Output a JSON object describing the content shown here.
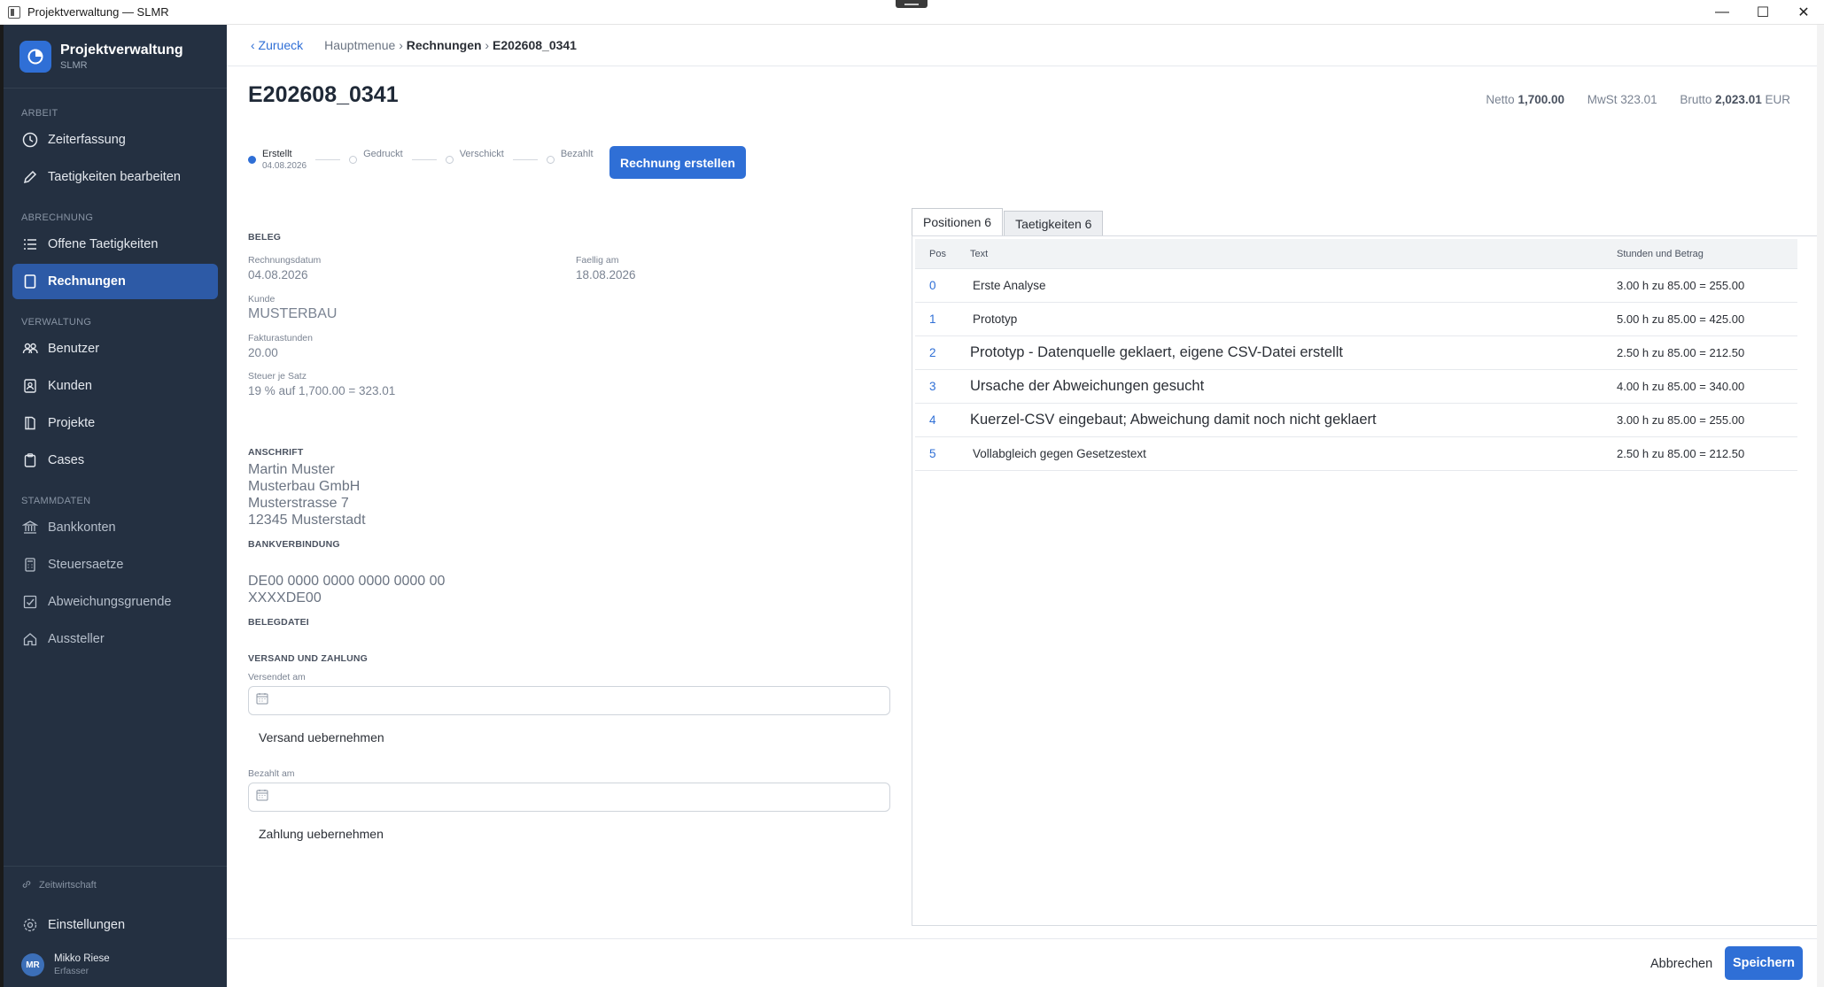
{
  "window": {
    "title": "Projektverwaltung — SLMR",
    "controls": [
      "—",
      "☐",
      "✕"
    ]
  },
  "brand": {
    "title": "Projektverwaltung",
    "subtitle": "SLMR"
  },
  "sidebar": {
    "sections": {
      "arbeit": "ARBEIT",
      "abrechnung": "ABRECHNUNG",
      "verwaltung": "VERWALTUNG",
      "stammdaten": "STAMMDATEN"
    },
    "items": {
      "zeiterfassung": "Zeiterfassung",
      "taetigkeiten_bearbeiten": "Taetigkeiten bearbeiten",
      "offene_taetigkeiten": "Offene Taetigkeiten",
      "rechnungen": "Rechnungen",
      "benutzer": "Benutzer",
      "kunden": "Kunden",
      "projekte": "Projekte",
      "cases": "Cases",
      "bankkonten": "Bankkonten",
      "steuersaetze": "Steuersaetze",
      "abweichungsgruende": "Abweichungsgruende",
      "aussteller": "Aussteller"
    },
    "footer": {
      "zeitwirtschaft": "Zeitwirtschaft",
      "einstellungen": "Einstellungen",
      "user_initials": "MR",
      "user_name": "Mikko Riese",
      "user_role": "Erfasser"
    }
  },
  "topbar": {
    "back": "‹ Zurueck",
    "crumb_home": "Hauptmenue",
    "sep": "›",
    "crumb_section": "Rechnungen",
    "crumb_current": "E202608_0341"
  },
  "invoice": {
    "title": "E202608_0341",
    "totals": {
      "netto_label": "Netto",
      "netto_value": "1,700.00",
      "mwst_label": "MwSt",
      "mwst_value": "323.01",
      "brutto_label": "Brutto",
      "brutto_value": "2,023.01",
      "currency": "EUR"
    },
    "status_steps": {
      "erstellt": "Erstellt",
      "erstellt_date": "04.08.2026",
      "gedruckt": "Gedruckt",
      "verschickt": "Verschickt",
      "bezahlt": "Bezahlt"
    },
    "create_button": "Rechnung erstellen"
  },
  "beleg": {
    "section": "BELEG",
    "rechnungsdatum_label": "Rechnungsdatum",
    "rechnungsdatum": "04.08.2026",
    "faellig_label": "Faellig am",
    "faellig": "18.08.2026",
    "kunde_label": "Kunde",
    "kunde": "MUSTERBAU",
    "fakturastunden_label": "Fakturastunden",
    "fakturastunden": "20.00",
    "steuer_label": "Steuer je Satz",
    "steuer": "19 % auf 1,700.00 = 323.01"
  },
  "anschrift": {
    "section": "ANSCHRIFT",
    "line1": "Martin Muster",
    "line2": "Musterbau GmbH",
    "line3": "Musterstrasse 7",
    "line4": "12345 Musterstadt"
  },
  "bank": {
    "section": "BANKVERBINDUNG",
    "iban": "DE00 0000 0000 0000 0000 00",
    "bic": "XXXXDE00"
  },
  "belegdatei": {
    "section": "BELEGDATEI"
  },
  "versand": {
    "section": "VERSAND UND ZAHLUNG",
    "versendet_label": "Versendet am",
    "versendet_value": "",
    "versand_button": "Versand uebernehmen",
    "bezahlt_label": "Bezahlt am",
    "bezahlt_value": "",
    "zahlung_button": "Zahlung uebernehmen"
  },
  "tabs": {
    "positionen": "Positionen 6",
    "taetigkeiten": "Taetigkeiten 6"
  },
  "table": {
    "headers": {
      "pos": "Pos",
      "text": "Text",
      "amount": "Stunden und Betrag"
    },
    "rows": [
      {
        "pos": "0",
        "text": "Erste Analyse",
        "amount": "3.00 h zu 85.00 = 255.00"
      },
      {
        "pos": "1",
        "text": "Prototyp",
        "amount": "5.00 h zu 85.00 = 425.00"
      },
      {
        "pos": "2",
        "text": "Prototyp - Datenquelle geklaert, eigene CSV-Datei erstellt",
        "amount": "2.50 h zu 85.00 = 212.50"
      },
      {
        "pos": "3",
        "text": "Ursache der Abweichungen gesucht",
        "amount": "4.00 h zu 85.00 = 340.00"
      },
      {
        "pos": "4",
        "text": "Kuerzel-CSV eingebaut; Abweichung damit noch nicht geklaert",
        "amount": "3.00 h zu 85.00 = 255.00"
      },
      {
        "pos": "5",
        "text": "Vollabgleich gegen Gesetzestext",
        "amount": "2.50 h zu 85.00 = 212.50"
      }
    ]
  },
  "actions": {
    "cancel": "Abbrechen",
    "save": "Speichern"
  },
  "colors": {
    "accent": "#2f6fd6",
    "sidebar": "#243041",
    "active_nav": "#2d5aa6"
  }
}
